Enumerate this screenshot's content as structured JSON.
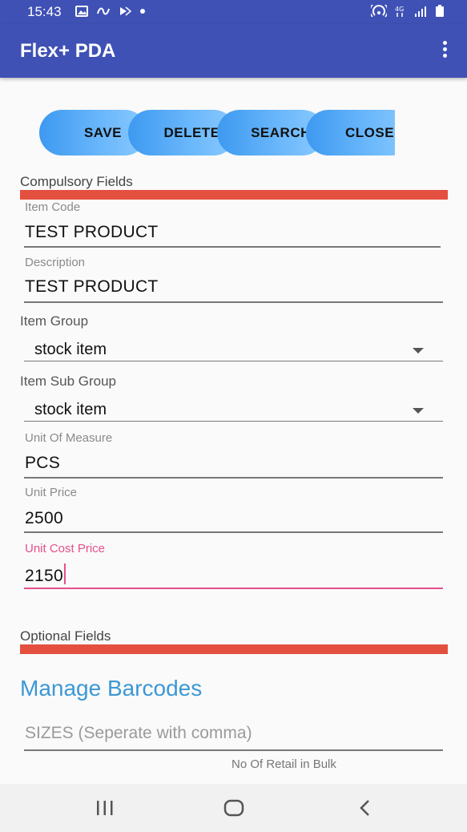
{
  "status_bar": {
    "time": "15:43",
    "icons_left": [
      "gallery-icon",
      "link-icon",
      "play-icon",
      "dot-icon"
    ],
    "icons_right": [
      "hotspot-icon",
      "signal-4g-icon",
      "signal-bars-icon",
      "battery-icon"
    ]
  },
  "app_bar": {
    "title": "Flex+ PDA",
    "menu_icon": "more-vert-icon"
  },
  "actions": {
    "save": "SAVE",
    "delete": "DELETE",
    "search": "SEARCH",
    "close": "CLOSE"
  },
  "compulsory": {
    "title": "Compulsory Fields",
    "item_code": {
      "label": "Item Code",
      "value": "TEST PRODUCT"
    },
    "description": {
      "label": "Description",
      "value": "TEST PRODUCT"
    },
    "item_group": {
      "label": "Item Group",
      "value": "stock item"
    },
    "item_sub_group": {
      "label": "Item Sub Group",
      "value": "stock item"
    },
    "unit_of_measure": {
      "label": "Unit Of Measure",
      "value": "PCS"
    },
    "unit_price": {
      "label": "Unit Price",
      "value": "2500"
    },
    "unit_cost_price": {
      "label": "Unit Cost Price",
      "value": "2150"
    }
  },
  "optional": {
    "title": "Optional Fields",
    "manage_barcodes": "Manage Barcodes",
    "sizes_placeholder": "SIZES (Seperate with comma)",
    "retail_in_bulk_label": "No Of Retail in Bulk"
  },
  "colors": {
    "primary": "#3f51b5",
    "accent": "#e64f8b",
    "section_bar": "#e4503f",
    "link": "#3c98d4"
  },
  "nav_bar": {
    "icons": [
      "recents-icon",
      "home-icon",
      "back-icon"
    ]
  }
}
